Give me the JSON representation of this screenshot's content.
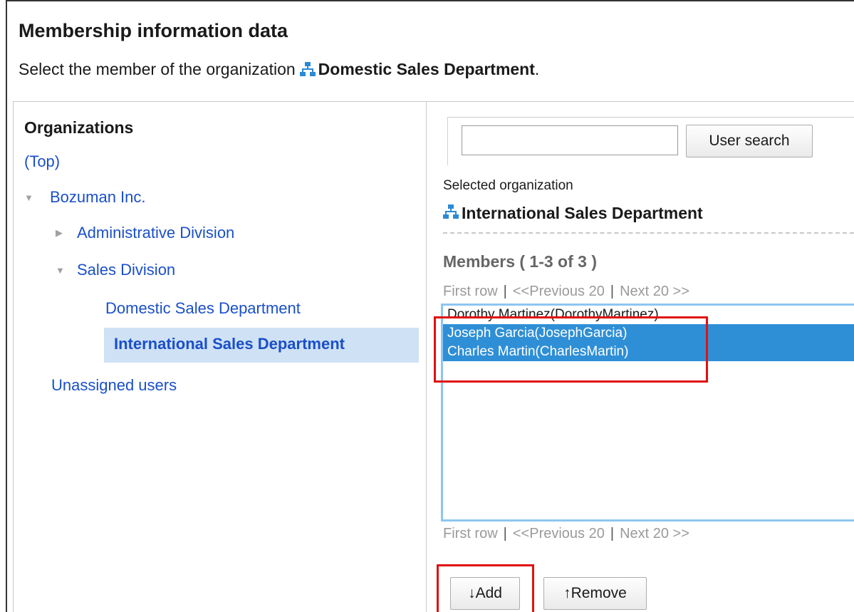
{
  "page": {
    "title": "Membership information data",
    "subtitle_prefix": "Select the member of the organization",
    "subtitle_org": "Domestic Sales Department",
    "subtitle_suffix": "."
  },
  "organizations": {
    "title": "Organizations",
    "top_link": "(Top)",
    "tree": [
      {
        "label": "Bozuman Inc.",
        "state": "expanded"
      },
      {
        "label": "Administrative Division",
        "state": "collapsed"
      },
      {
        "label": "Sales Division",
        "state": "expanded"
      },
      {
        "label": "Domestic Sales Department",
        "state": "leaf"
      },
      {
        "label": "International Sales Department",
        "state": "selected"
      }
    ],
    "unassigned": "Unassigned users"
  },
  "search": {
    "value": "",
    "button_label": "User search"
  },
  "selected_org": {
    "label": "Selected organization",
    "name": "International Sales Department"
  },
  "members": {
    "title": "Members ( 1-3 of 3 )",
    "pager": {
      "first": "First row",
      "sep": "|",
      "prev": "<<Previous 20",
      "next": "Next 20 >>"
    },
    "list": [
      {
        "text": "Dorothy Martinez(DorothyMartinez)",
        "selected": false
      },
      {
        "text": "Joseph Garcia(JosephGarcia)",
        "selected": true
      },
      {
        "text": "Charles Martin(CharlesMartin)",
        "selected": true
      }
    ]
  },
  "actions": {
    "add_label": "↓Add",
    "remove_label": "↑Remove"
  },
  "colors": {
    "link": "#1a4fc9",
    "selected_tree_bg": "#cfe1f5",
    "selected_option_bg": "#2f8fd6",
    "listbox_border": "#8cc6f0",
    "annotation_red": "#e01010",
    "org_icon": "#2a8ad6"
  },
  "icons": {
    "organization": "org-chart-icon",
    "expanded": "triangle-down-icon",
    "collapsed": "triangle-right-icon"
  }
}
